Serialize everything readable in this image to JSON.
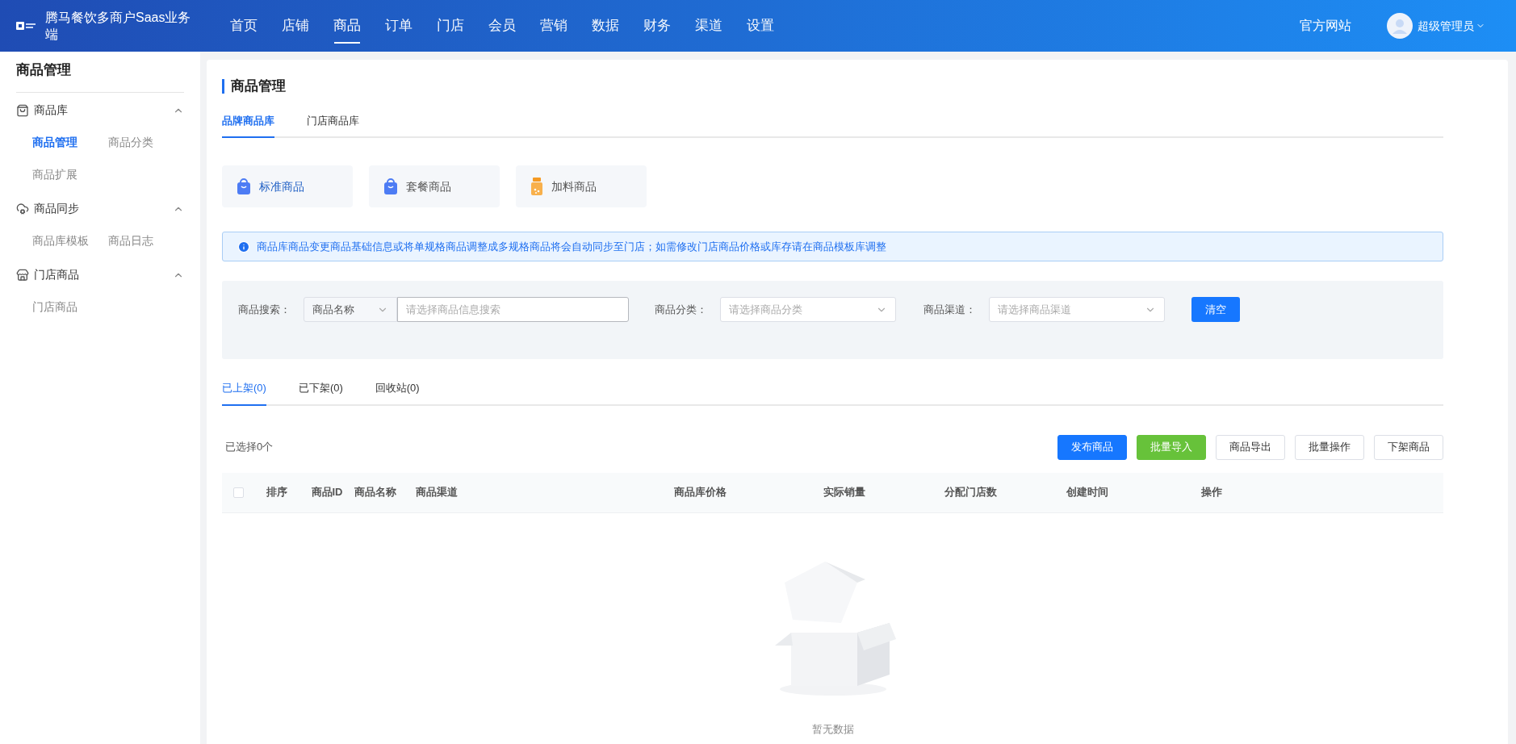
{
  "header": {
    "logo_text": "腾马餐饮多商户Saas业务端",
    "nav": [
      {
        "label": "首页",
        "selected": false
      },
      {
        "label": "店铺",
        "selected": false
      },
      {
        "label": "商品",
        "selected": true
      },
      {
        "label": "订单",
        "selected": false
      },
      {
        "label": "门店",
        "selected": false
      },
      {
        "label": "会员",
        "selected": false
      },
      {
        "label": "营销",
        "selected": false
      },
      {
        "label": "数据",
        "selected": false
      },
      {
        "label": "财务",
        "selected": false
      },
      {
        "label": "渠道",
        "selected": false
      },
      {
        "label": "设置",
        "selected": false
      }
    ],
    "official_site": "官方网站",
    "user": "超级管理员"
  },
  "sidebar": {
    "title": "商品管理",
    "groups": [
      {
        "label": "商品库",
        "kind": "bag",
        "expanded": true,
        "children": [
          {
            "label": "商品管理",
            "selected": true
          },
          {
            "label": "商品分类",
            "selected": false
          },
          {
            "label": "商品扩展",
            "selected": false
          }
        ]
      },
      {
        "label": "商品同步",
        "kind": "cloud",
        "expanded": true,
        "children": [
          {
            "label": "商品库模板",
            "selected": false
          },
          {
            "label": "商品日志",
            "selected": false
          }
        ]
      },
      {
        "label": "门店商品",
        "kind": "store",
        "expanded": true,
        "children": [
          {
            "label": "门店商品",
            "selected": false
          }
        ]
      }
    ]
  },
  "page": {
    "title": "商品管理",
    "library_tabs": [
      {
        "label": "品牌商品库",
        "selected": true
      },
      {
        "label": "门店商品库",
        "selected": false
      }
    ],
    "product_types": [
      {
        "label": "标准商品",
        "kind": "bag",
        "selected": true
      },
      {
        "label": "套餐商品",
        "kind": "bag",
        "selected": false
      },
      {
        "label": "加料商品",
        "kind": "jar",
        "selected": false
      }
    ],
    "alert": "商品库商品变更商品基础信息或将单规格商品调整成多规格商品将会自动同步至门店；如需修改门店商品价格或库存请在商品模板库调整",
    "filters": {
      "search": {
        "label": "商品搜索：",
        "select_value": "商品名称",
        "placeholder": "请选择商品信息搜索"
      },
      "category": {
        "label": "商品分类：",
        "placeholder": "请选择商品分类"
      },
      "channel": {
        "label": "商品渠道：",
        "placeholder": "请选择商品渠道"
      },
      "clear_button": "清空"
    },
    "status_tabs": [
      {
        "label": "已上架(0)",
        "selected": true
      },
      {
        "label": "已下架(0)",
        "selected": false
      },
      {
        "label": "回收站(0)",
        "selected": false
      }
    ],
    "selected_count": "已选择0个",
    "actions": [
      {
        "label": "发布商品",
        "kind": "primary"
      },
      {
        "label": "批量导入",
        "kind": "success"
      },
      {
        "label": "商品导出",
        "kind": "default"
      },
      {
        "label": "批量操作",
        "kind": "default"
      },
      {
        "label": "下架商品",
        "kind": "default"
      }
    ],
    "table": {
      "select_all_checked": false,
      "columns": [
        "排序",
        "商品ID",
        "商品名称",
        "商品渠道",
        "商品库价格",
        "实际销量",
        "分配门店数",
        "创建时间",
        "操作"
      ],
      "empty_text": "暂无数据"
    }
  }
}
